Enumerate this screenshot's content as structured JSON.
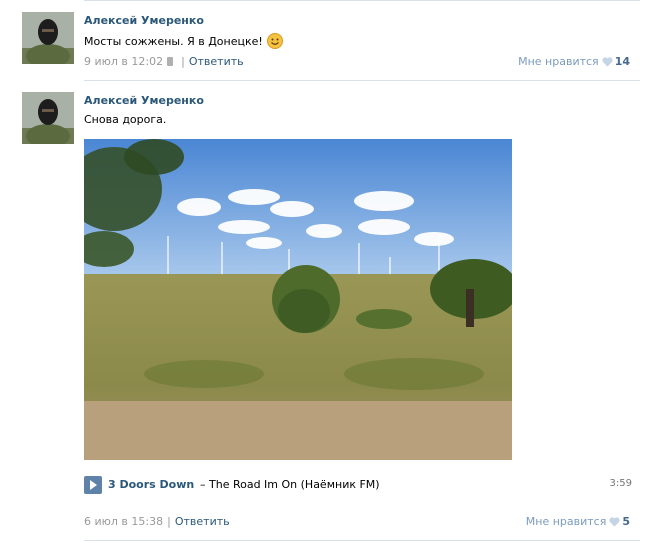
{
  "posts": [
    {
      "author": "Алексей Умеренко",
      "text": "Мосты сожжены. Я в Донецке!",
      "emoji": "smile-emoji",
      "date": "9 июл в 12:02",
      "divider": "|",
      "reply": "Ответить",
      "like_label": "Мне нравится",
      "like_count": "14"
    },
    {
      "author": "Алексей Умеренко",
      "text": "Снова дорога.",
      "date": "6 июл в 15:38",
      "divider": "|",
      "reply": "Ответить",
      "like_label": "Мне нравится",
      "like_count": "5",
      "audio": {
        "artist": "3 Doors Down",
        "title": "– The Road Im On (Наёмник FM)",
        "duration": "3:59"
      }
    }
  ],
  "colors": {
    "link": "#2b587a",
    "muted": "#999999",
    "separator": "#dae1e8",
    "play_button": "#5e82a8"
  }
}
